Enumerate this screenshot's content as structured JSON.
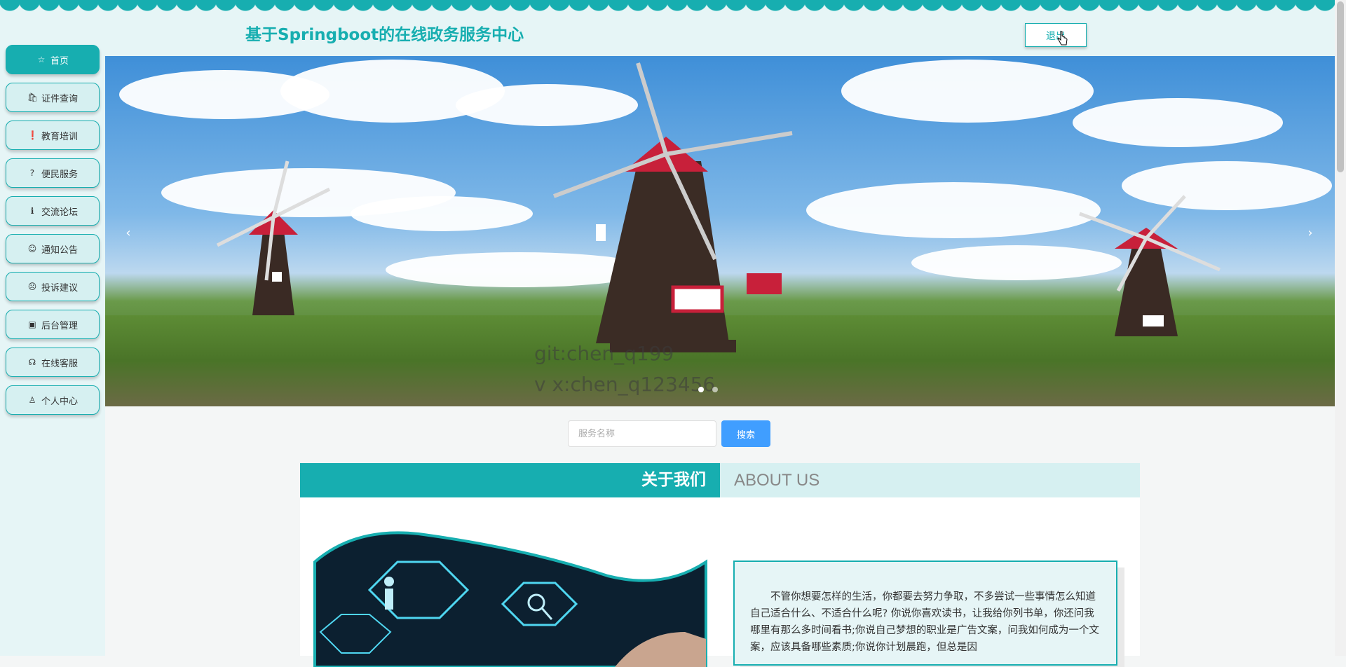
{
  "header": {
    "title": "基于Springboot的在线政务服务中心",
    "logout_label": "退出"
  },
  "sidebar": {
    "items": [
      {
        "label": "首页",
        "icon": "star-icon",
        "active": true
      },
      {
        "label": "证件查询",
        "icon": "bag-icon"
      },
      {
        "label": "教育培训",
        "icon": "alert-icon"
      },
      {
        "label": "便民服务",
        "icon": "question-icon"
      },
      {
        "label": "交流论坛",
        "icon": "info-icon"
      },
      {
        "label": "通知公告",
        "icon": "smile-icon"
      },
      {
        "label": "投诉建议",
        "icon": "face-icon"
      },
      {
        "label": "后台管理",
        "icon": "box-icon"
      },
      {
        "label": "在线客服",
        "icon": "headset-icon"
      },
      {
        "label": "个人中心",
        "icon": "user-icon"
      }
    ]
  },
  "banner": {
    "watermark_line1": "git:chen_q199",
    "watermark_line2": "v x:chen_q123456",
    "prev_arrow": "‹",
    "next_arrow": "›",
    "slide_count": 2,
    "active_slide": 1
  },
  "search": {
    "placeholder": "服务名称",
    "button_label": "搜索"
  },
  "about": {
    "title_cn": "关于我们",
    "title_en": "ABOUT US",
    "text": "不管你想要怎样的生活，你都要去努力争取，不多尝试一些事情怎么知道自己适合什么、不适合什么呢? 你说你喜欢读书，让我给你列书单，你还问我哪里有那么多时间看书;你说自己梦想的职业是广告文案，问我如何成为一个文案，应该具备哪些素质;你说你计划晨跑，但总是因"
  },
  "colors": {
    "accent": "#17aeb0",
    "accent_light": "#d6f0f1",
    "search_button": "#409eff"
  }
}
